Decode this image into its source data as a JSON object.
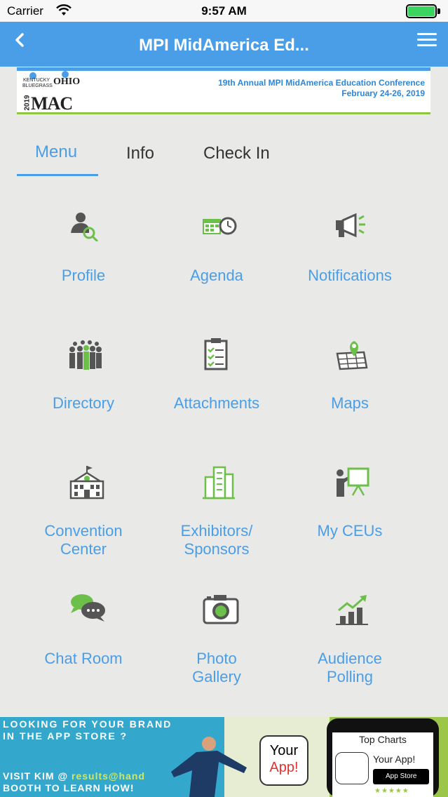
{
  "status": {
    "carrier": "Carrier",
    "time": "9:57 AM"
  },
  "nav": {
    "title": "MPI MidAmerica Ed..."
  },
  "banner": {
    "logo_year": "2019",
    "logo_mac": "MAC",
    "logo_ky": "KENTUCKY BLUEGRASS",
    "logo_oh": "OHIO",
    "line1": "19th Annual MPI MidAmerica Education Conference",
    "line2": "February 24-26, 2019"
  },
  "tabs": [
    {
      "label": "Menu",
      "active": true
    },
    {
      "label": "Info",
      "active": false
    },
    {
      "label": "Check In",
      "active": false
    }
  ],
  "menu_items": [
    {
      "label": "Profile",
      "icon": "profile-search-icon"
    },
    {
      "label": "Agenda",
      "icon": "calendar-clock-icon"
    },
    {
      "label": "Notifications",
      "icon": "megaphone-icon"
    },
    {
      "label": "Directory",
      "icon": "people-group-icon"
    },
    {
      "label": "Attachments",
      "icon": "clipboard-list-icon"
    },
    {
      "label": "Maps",
      "icon": "map-pin-icon"
    },
    {
      "label": "Convention\nCenter",
      "icon": "building-clock-icon"
    },
    {
      "label": "Exhibitors/\nSponsors",
      "icon": "city-buildings-icon"
    },
    {
      "label": "My CEUs",
      "icon": "presentation-board-icon"
    },
    {
      "label": "Chat Room",
      "icon": "chat-bubbles-icon"
    },
    {
      "label": "Photo\nGallery",
      "icon": "camera-icon"
    },
    {
      "label": "Audience\nPolling",
      "icon": "bar-chart-trend-icon"
    }
  ],
  "ad": {
    "line1": "LOOKING FOR YOUR BRAND",
    "line2": "IN THE APP STORE ?",
    "line3a": "VISIT KIM @ ",
    "line3b": "results@hand",
    "line4": "BOOTH TO LEARN HOW!",
    "your": "Your",
    "app": "App!",
    "top_charts": "Top Charts",
    "your_app": "Your App!",
    "store": "App Store",
    "stars": "★★★★★"
  },
  "colors": {
    "accent": "#4a9ee7",
    "icon_green": "#6cc04a",
    "icon_gray": "#555555"
  }
}
